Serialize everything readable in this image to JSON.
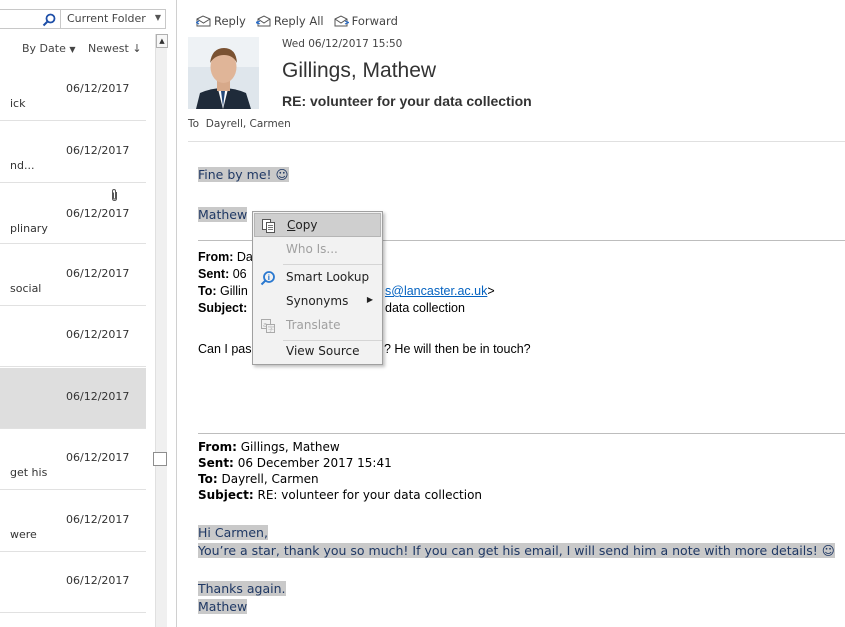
{
  "list": {
    "scope_label": "Current Folder",
    "sort_by": "By Date",
    "sort_order": "Newest",
    "items": [
      {
        "date": "06/12/2017",
        "snippet": "ick",
        "attachment": false,
        "selected": false
      },
      {
        "date": "06/12/2017",
        "snippet": "nd...",
        "attachment": false,
        "selected": false
      },
      {
        "date": "06/12/2017",
        "snippet": "plinary",
        "attachment": true,
        "selected": false
      },
      {
        "date": "06/12/2017",
        "snippet": "social",
        "attachment": false,
        "selected": false
      },
      {
        "date": "06/12/2017",
        "snippet": "",
        "attachment": false,
        "selected": false
      },
      {
        "date": "06/12/2017",
        "snippet": "",
        "attachment": false,
        "selected": true
      },
      {
        "date": "06/12/2017",
        "snippet": "get his",
        "attachment": false,
        "selected": false
      },
      {
        "date": "06/12/2017",
        "snippet": "were",
        "attachment": false,
        "selected": false
      },
      {
        "date": "06/12/2017",
        "snippet": "",
        "attachment": false,
        "selected": false
      }
    ]
  },
  "toolbar": {
    "reply": "Reply",
    "reply_all": "Reply All",
    "forward": "Forward"
  },
  "message": {
    "datetime": "Wed 06/12/2017 15:50",
    "sender": "Gillings, Mathew",
    "subject": "RE: volunteer for your data collection",
    "to_label": "To",
    "to": "Dayrell, Carmen",
    "body_line1": "Fine by me! ☺",
    "body_line2": "Mathew",
    "quoted1": {
      "from_label": "From:",
      "from": "Da",
      "sent_label": "Sent:",
      "sent": "06",
      "to_label": "To:",
      "to": "Gillin",
      "to_email": "s@lancaster.ac.uk",
      "to_close": ">",
      "subject_label": "Subject:",
      "subject": "data collection",
      "body_start": "Can I pas",
      "body_end": "? He will then be in touch?"
    },
    "quoted2": {
      "from_label": "From:",
      "from": "Gillings, Mathew",
      "sent_label": "Sent:",
      "sent": "06 December 2017 15:41",
      "to_label": "To:",
      "to": "Dayrell, Carmen",
      "subject_label": "Subject:",
      "subject": "RE: volunteer for your data collection",
      "greeting": "Hi Carmen,",
      "line1": "You’re a star, thank you so much! If you can get his email, I will send him a note with more details! ☺",
      "thanks": "Thanks again.",
      "sign": "Mathew"
    }
  },
  "context_menu": {
    "items": [
      {
        "label": "Copy",
        "icon": "copy-icon",
        "enabled": true
      },
      {
        "label": "Who Is...",
        "icon": "",
        "enabled": false
      },
      {
        "label": "Smart Lookup",
        "icon": "smart-lookup-icon",
        "enabled": true
      },
      {
        "label": "Synonyms",
        "icon": "",
        "enabled": true,
        "submenu": true
      },
      {
        "label": "Translate",
        "icon": "translate-icon",
        "enabled": false
      },
      {
        "label": "View Source",
        "icon": "",
        "enabled": true
      }
    ]
  },
  "colors": {
    "highlight": "#c9c9c9",
    "highlight_text": "#1f3864",
    "link": "#0563c1",
    "smart_lookup": "#2b79d0"
  }
}
